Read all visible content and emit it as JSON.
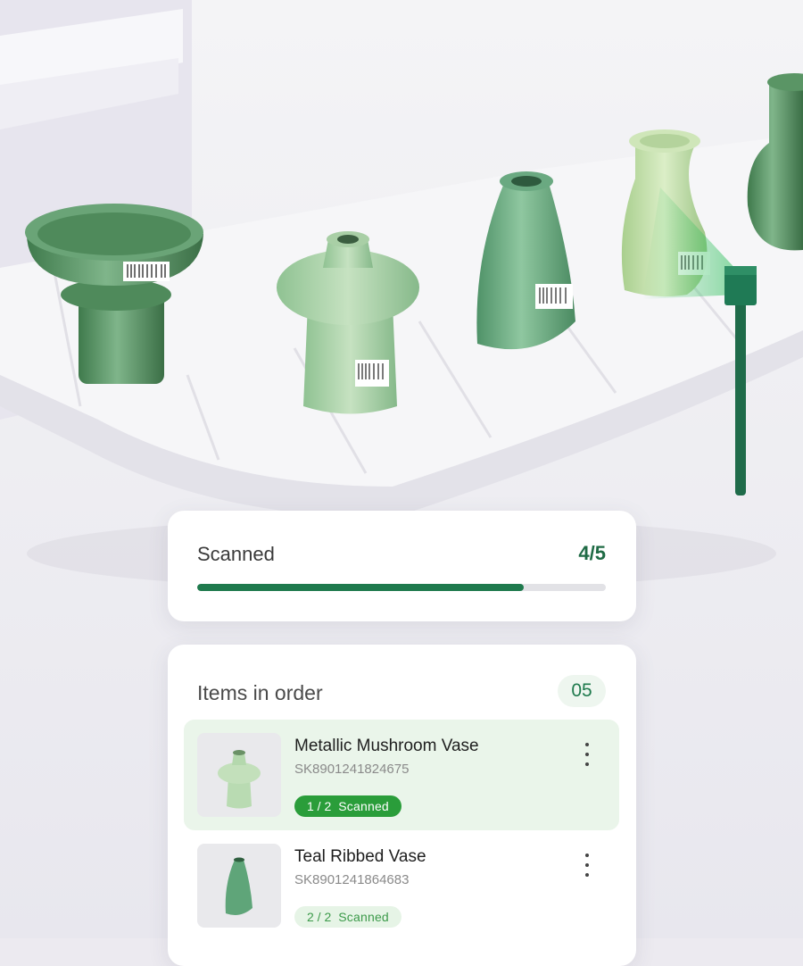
{
  "scan_status": {
    "label": "Scanned",
    "count_text": "4/5",
    "progress_fraction": 0.8
  },
  "order": {
    "title": "Items in order",
    "count": "05",
    "items": [
      {
        "name": "Metallic Mushroom Vase",
        "sku": "SK8901241824675",
        "scanned_count": "1 / 2",
        "scanned_label": "Scanned",
        "highlighted": true,
        "thumb_icon": "mushroom-vase-icon"
      },
      {
        "name": "Teal Ribbed Vase",
        "sku": "SK8901241864683",
        "scanned_count": "2 / 2",
        "scanned_label": "Scanned",
        "highlighted": false,
        "thumb_icon": "teal-vase-icon"
      }
    ]
  },
  "colors": {
    "accent": "#1f7a4d",
    "badge_partial": "#2a9d3a",
    "badge_complete_bg": "#e6f4e6",
    "highlight_row": "#eaf5ea",
    "vase_green": "#5f9e6a"
  }
}
